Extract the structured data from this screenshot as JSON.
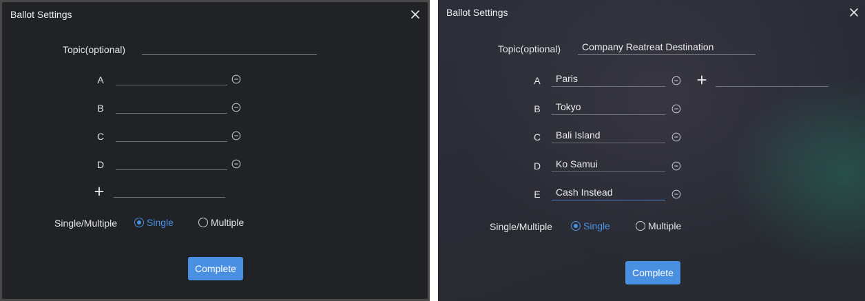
{
  "left_dialog": {
    "title": "Ballot Settings",
    "close_icon": "close-icon",
    "topic_label": "Topic(optional)",
    "topic_value": "",
    "options": [
      {
        "letter": "A",
        "value": ""
      },
      {
        "letter": "B",
        "value": ""
      },
      {
        "letter": "C",
        "value": ""
      },
      {
        "letter": "D",
        "value": ""
      }
    ],
    "add_option_icon": "plus-icon",
    "new_option_value": "",
    "mode_label": "Single/Multiple",
    "single_label": "Single",
    "multiple_label": "Multiple",
    "selected_mode": "Single",
    "complete_label": "Complete"
  },
  "right_dialog": {
    "title": "Ballot Settings",
    "close_icon": "close-icon",
    "topic_label": "Topic(optional)",
    "topic_value": "Company Reatreat Destination",
    "options": [
      {
        "letter": "A",
        "value": "Paris"
      },
      {
        "letter": "B",
        "value": "Tokyo"
      },
      {
        "letter": "C",
        "value": "Bali Island"
      },
      {
        "letter": "D",
        "value": "Ko Samui"
      },
      {
        "letter": "E",
        "value": "Cash Instead"
      }
    ],
    "add_option_icon": "plus-icon",
    "new_option_value": "",
    "mode_label": "Single/Multiple",
    "single_label": "Single",
    "multiple_label": "Multiple",
    "selected_mode": "Single",
    "complete_label": "Complete"
  },
  "colors": {
    "accent": "#4a90e2",
    "dialog_background": "#202226",
    "text": "#e6e6e6"
  }
}
